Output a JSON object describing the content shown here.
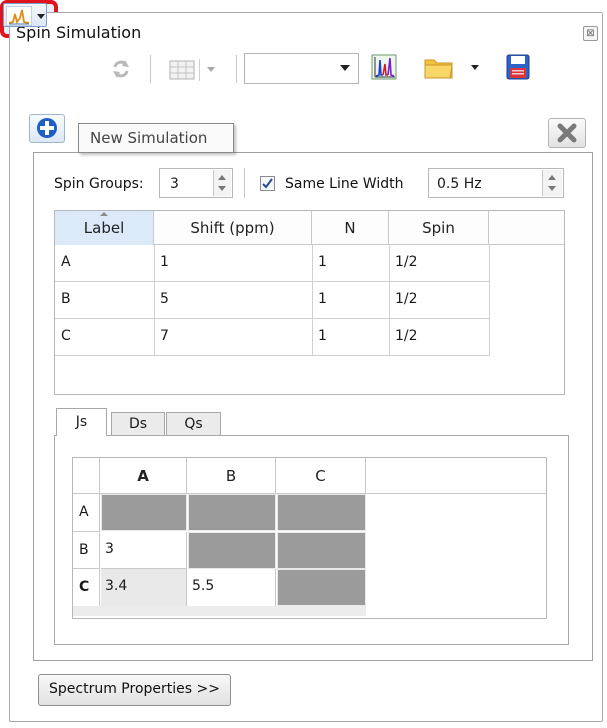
{
  "window": {
    "title": "Spin Simulation",
    "close_glyph": "⊠"
  },
  "toolbar": {
    "new_simulation_icon": "spectrum-icon",
    "refresh_icon": "refresh-icon",
    "table_icon": "table-icon",
    "combo_value": "",
    "spectrum_icon": "spectrum-colored-icon",
    "open_icon": "folder-icon",
    "save_icon": "save-icon"
  },
  "tooltip": {
    "text": "New Simulation"
  },
  "spin_groups": {
    "label": "Spin Groups:",
    "value": "3",
    "same_line_width_label": "Same Line Width",
    "same_line_width_checked": true,
    "line_width_value": "0.5 Hz"
  },
  "spin_table": {
    "headers": [
      "Label",
      "Shift (ppm)",
      "N",
      "Spin"
    ],
    "rows": [
      [
        "A",
        "1",
        "1",
        "1/2"
      ],
      [
        "B",
        "5",
        "1",
        "1/2"
      ],
      [
        "C",
        "7",
        "1",
        "1/2"
      ]
    ]
  },
  "coupling_tabs": [
    "Js",
    "Ds",
    "Qs"
  ],
  "coupling_table": {
    "headers": [
      "A",
      "B",
      "C"
    ],
    "rows": [
      {
        "label": "A",
        "values": [
          "",
          "",
          ""
        ]
      },
      {
        "label": "B",
        "values": [
          "3",
          "",
          ""
        ]
      },
      {
        "label": "C",
        "values": [
          "3.4",
          "5.5",
          ""
        ]
      }
    ]
  },
  "spectrum_properties_button": "Spectrum Properties >>",
  "colors": {
    "highlight": "#e0141d",
    "disabled_cell": "#9b9b9b",
    "selected_header": "#dce9f8"
  }
}
